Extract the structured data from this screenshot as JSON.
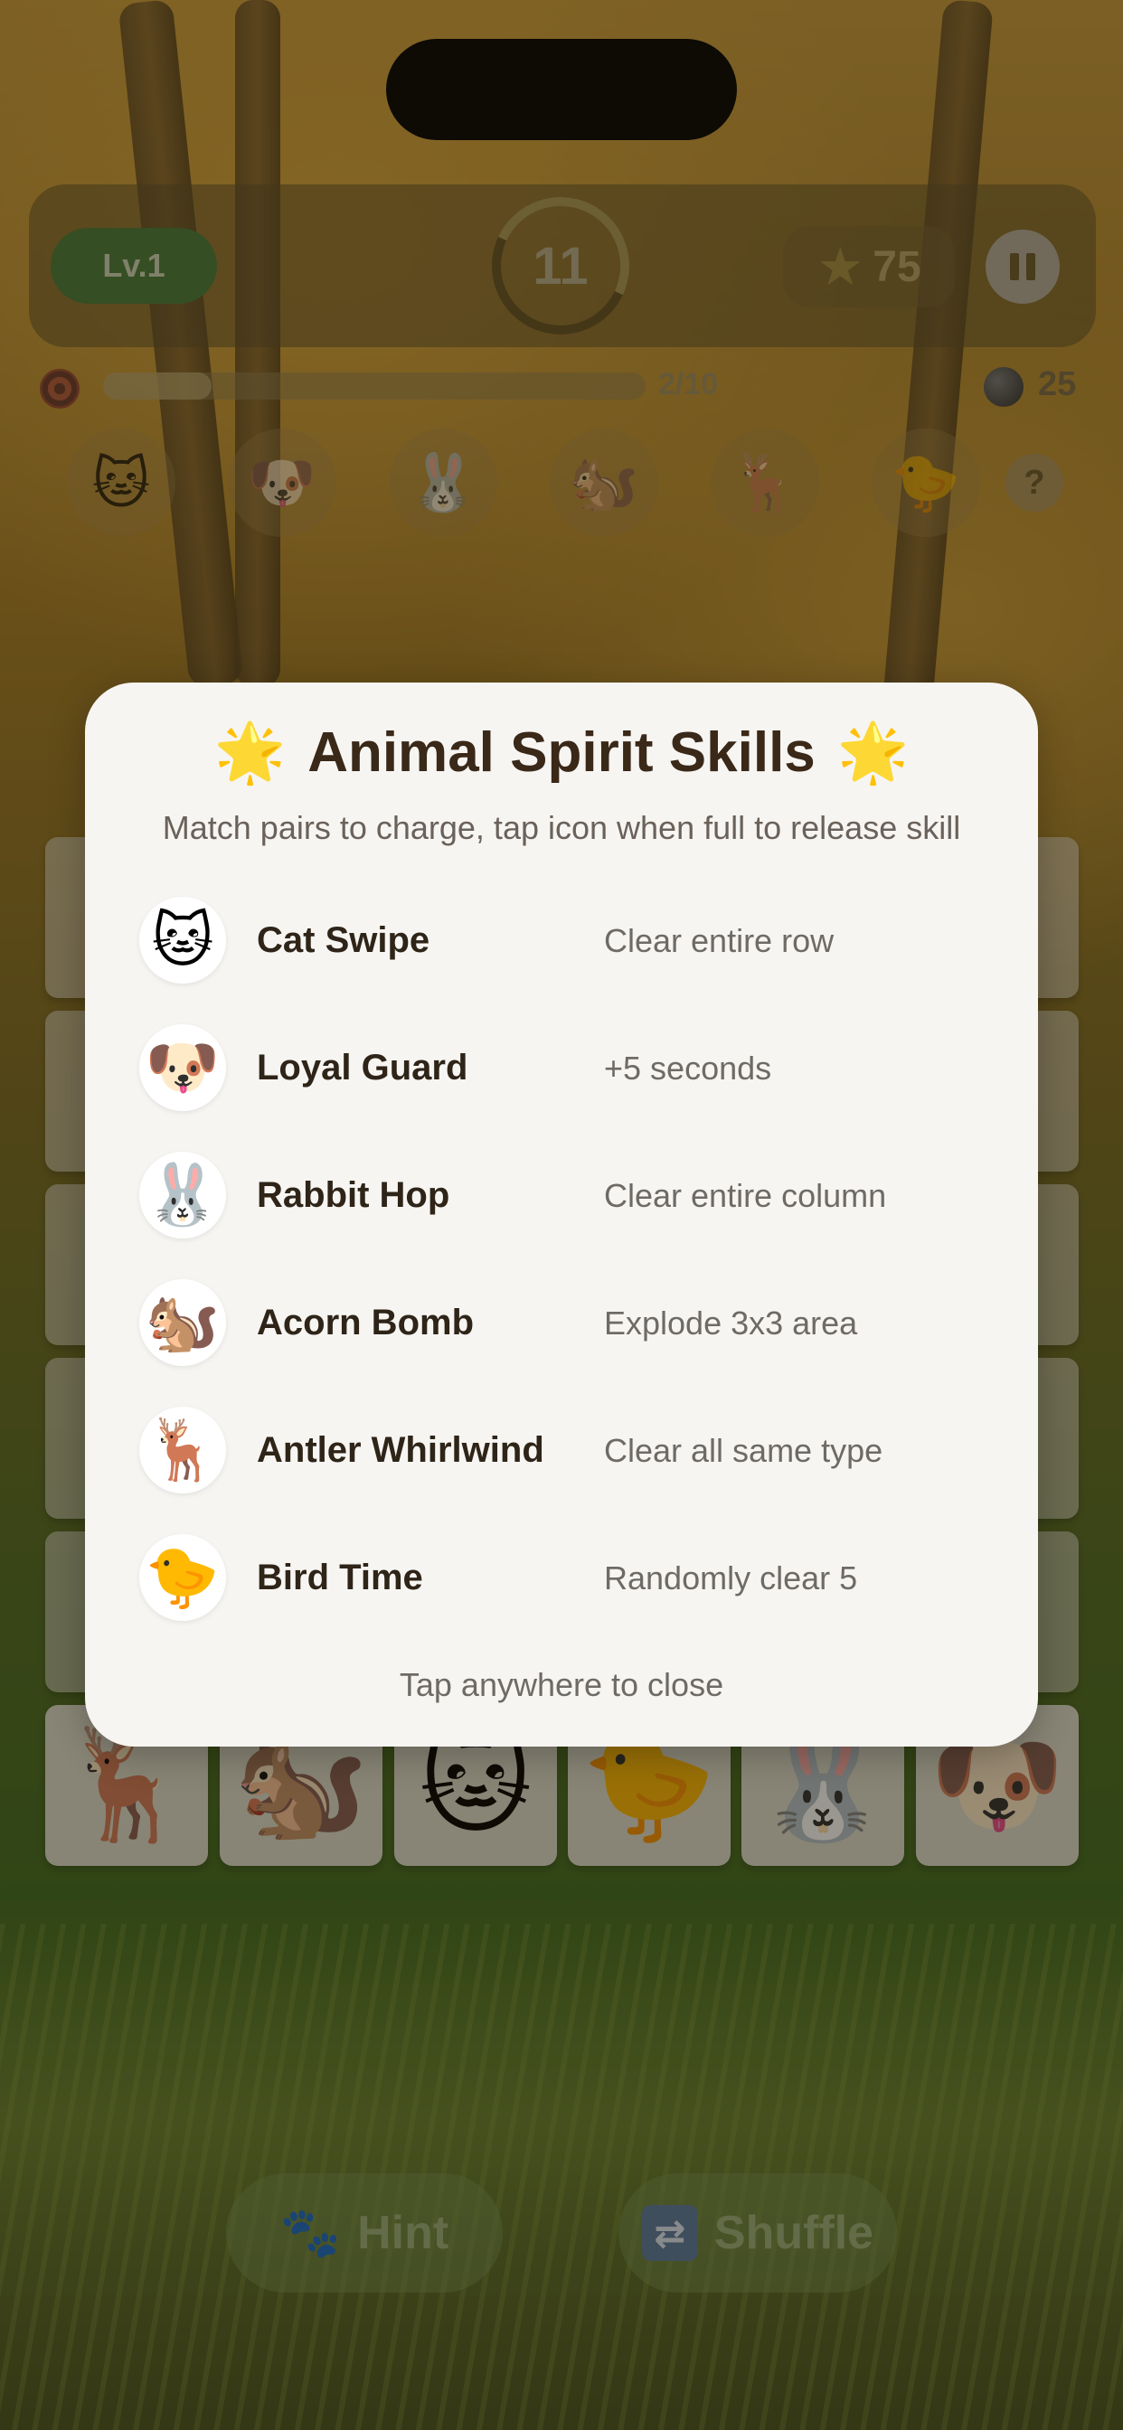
{
  "hud": {
    "level": "Lv.1",
    "timer": "11",
    "score": "75",
    "progress_text": "2/10",
    "progress": 0.2,
    "coins": "25"
  },
  "icons": {
    "star": "star-icon",
    "pause": "pause-icon",
    "target": "target-icon",
    "coin": "coin-icon",
    "help": "?"
  },
  "skill_bar": [
    "🐱",
    "🐶",
    "🐰",
    "🐿️",
    "🦌",
    "🐤"
  ],
  "board_bottom_row": [
    "🦌",
    "🐿️",
    "🐱",
    "🐤",
    "🐰",
    "🐶"
  ],
  "modal": {
    "title": "Animal Spirit Skills",
    "title_icon": "🌟",
    "subtitle": "Match pairs to charge, tap icon when full to release skill",
    "skills": [
      {
        "emoji": "🐱",
        "name": "Cat Swipe",
        "desc": "Clear entire row"
      },
      {
        "emoji": "🐶",
        "name": "Loyal Guard",
        "desc": "+5 seconds"
      },
      {
        "emoji": "🐰",
        "name": "Rabbit Hop",
        "desc": "Clear entire column"
      },
      {
        "emoji": "🐿️",
        "name": "Acorn Bomb",
        "desc": "Explode 3x3 area"
      },
      {
        "emoji": "🦌",
        "name": "Antler Whirlwind",
        "desc": "Clear all same type"
      },
      {
        "emoji": "🐤",
        "name": "Bird Time",
        "desc": "Randomly clear 5"
      }
    ],
    "footer": "Tap anywhere to close"
  },
  "buttons": {
    "hint": "Hint",
    "shuffle": "Shuffle"
  },
  "colors": {
    "modal_bg": "#f7f5f2",
    "title_text": "#3a2818",
    "level_badge": "#4a7a3a"
  }
}
